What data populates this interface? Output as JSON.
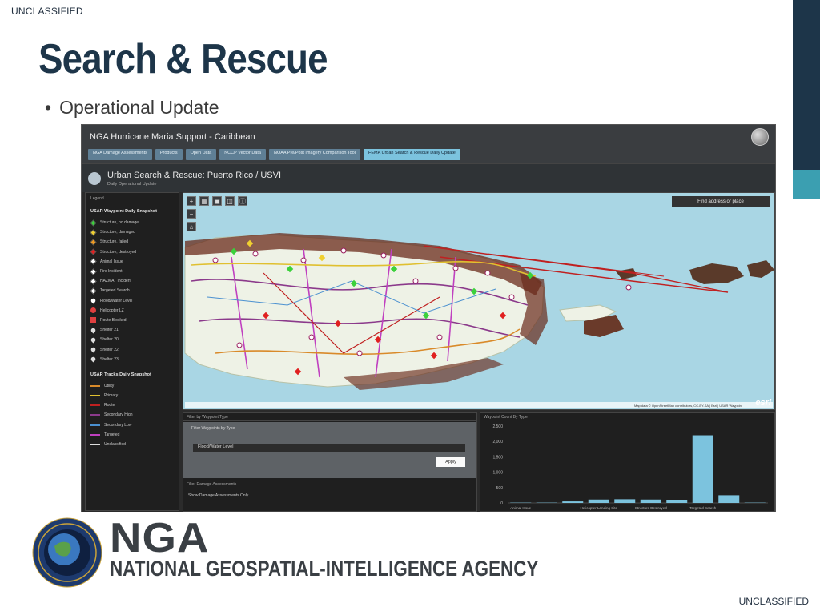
{
  "classification": {
    "top": "UNCLASSIFIED",
    "bottom": "UNCLASSIFIED"
  },
  "slide": {
    "title": "Search & Rescue",
    "bullet": "Operational Update"
  },
  "app": {
    "header_title": "NGA Hurricane Maria Support - Caribbean",
    "tabs": [
      {
        "label": "NGA Damage Assessments"
      },
      {
        "label": "Products"
      },
      {
        "label": "Open Data"
      },
      {
        "label": "NCCP Vector Data"
      },
      {
        "label": "NOAA Pre/Post Imagery Comparison Tool"
      },
      {
        "label": "FEMA Urban Search & Rescue Daily Update"
      }
    ],
    "page_title": "Urban Search & Rescue: Puerto Rico / USVI",
    "page_subtitle": "Daily Operational Update",
    "legend": {
      "panel_title": "Legend",
      "section1": "USAR Waypoint Daily Snapshot",
      "waypoints": [
        {
          "label": "Structure, no damage",
          "color": "#3bd13b",
          "shape": "diamond"
        },
        {
          "label": "Structure, damaged",
          "color": "#f0d030",
          "shape": "diamond"
        },
        {
          "label": "Structure, failed",
          "color": "#f09a20",
          "shape": "diamond"
        },
        {
          "label": "Structure, destroyed",
          "color": "#e02020",
          "shape": "diamond"
        },
        {
          "label": "Animal Issue",
          "color": "#ffffff",
          "shape": "diamond"
        },
        {
          "label": "Fire Incident",
          "color": "#ffffff",
          "shape": "diamond"
        },
        {
          "label": "HAZMAT Incident",
          "color": "#ffffff",
          "shape": "diamond"
        },
        {
          "label": "Targeted Search",
          "color": "#ffffff",
          "shape": "diamond"
        },
        {
          "label": "Flood/Water Level",
          "color": "#ffffff",
          "shape": "pin"
        },
        {
          "label": "Helicopter LZ",
          "color": "#e04040",
          "shape": "circle"
        },
        {
          "label": "Route Blocked",
          "color": "#e04040",
          "shape": "square"
        },
        {
          "label": "Shelter 21",
          "color": "#dddddd",
          "shape": "pin"
        },
        {
          "label": "Shelter 20",
          "color": "#dddddd",
          "shape": "pin"
        },
        {
          "label": "Shelter 22",
          "color": "#dddddd",
          "shape": "pin"
        },
        {
          "label": "Shelter 23",
          "color": "#dddddd",
          "shape": "pin"
        }
      ],
      "section2": "USAR Tracks Daily Snapshot",
      "tracks": [
        {
          "label": "Utility",
          "color": "#d98a2a"
        },
        {
          "label": "Primary",
          "color": "#e0c030"
        },
        {
          "label": "Route",
          "color": "#c02020"
        },
        {
          "label": "Secondary High",
          "color": "#8b3a8b"
        },
        {
          "label": "Secondary Low",
          "color": "#4a90d0"
        },
        {
          "label": "Targeted",
          "color": "#c040c0"
        },
        {
          "label": "Unclassified",
          "color": "#dddddd"
        }
      ]
    },
    "map": {
      "tools": [
        "+",
        "▦",
        "▣",
        "◫",
        "ⓘ"
      ],
      "search_placeholder": "Find address or place",
      "attribution": "Map data © OpenStreetMap contributors, CC-BY-SA | Esri | USAR Waypoint",
      "esri": "esri"
    },
    "filter_panel": {
      "title": "Filter by Waypoint Type",
      "header": "Filter Waypoints by Type",
      "selected": "Flood/Water Level",
      "apply": "Apply",
      "title2": "Filter Damage Assessments",
      "row2": "Show Damage Assessments Only"
    },
    "chart_panel": {
      "title": "Waypoint Count By Type"
    }
  },
  "chart_data": {
    "type": "bar",
    "categories": [
      "Animal Issue",
      "",
      "Helicopter Landing Site",
      "",
      "Structure Destroyed",
      "",
      "Targeted Search",
      ""
    ],
    "values": [
      10,
      10,
      50,
      110,
      120,
      110,
      80,
      2200,
      250,
      10
    ],
    "ylim": [
      0,
      2500
    ],
    "yticks": [
      0,
      500,
      1000,
      1500,
      2000,
      2500
    ],
    "ytick_labels": [
      "0",
      "500",
      "1,000",
      "1,500",
      "2,000",
      "2,500"
    ],
    "xtick_labels": [
      "Animal Issue",
      "Helicopter Landing Site",
      "Structure Destroyed",
      "Targeted Search"
    ],
    "color": "#7cc3de",
    "grid": false
  },
  "logo": {
    "acronym": "NGA",
    "name": "NATIONAL GEOSPATIAL-INTELLIGENCE AGENCY"
  }
}
